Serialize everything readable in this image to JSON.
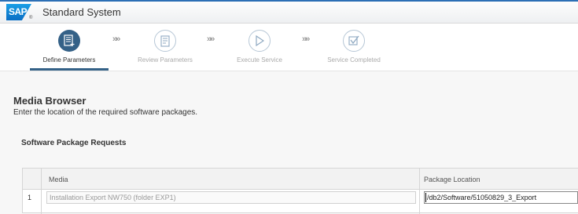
{
  "header": {
    "logo_text": "SAP",
    "logo_mark": "®",
    "title": "Standard System"
  },
  "wizard": {
    "arrow_glyph": "»»",
    "steps": [
      {
        "label": "Define Parameters",
        "icon": "form-icon",
        "state": "active"
      },
      {
        "label": "Review Parameters",
        "icon": "document-icon",
        "state": "inactive"
      },
      {
        "label": "Execute Service",
        "icon": "play-icon",
        "state": "inactive"
      },
      {
        "label": "Service Completed",
        "icon": "checkbox-icon",
        "state": "inactive"
      }
    ]
  },
  "content": {
    "title": "Media Browser",
    "description": "Enter the location of the required software packages.",
    "section_title": "Software Package Requests"
  },
  "table": {
    "columns": [
      "Media",
      "Package Location"
    ],
    "rows": [
      {
        "index": "1",
        "media": "Installation Export NW750 (folder EXP1)",
        "location": "/db2/Software/51050829_3_Export"
      }
    ]
  },
  "colors": {
    "accent": "#346187",
    "topbar_border": "#2c6fb5"
  }
}
